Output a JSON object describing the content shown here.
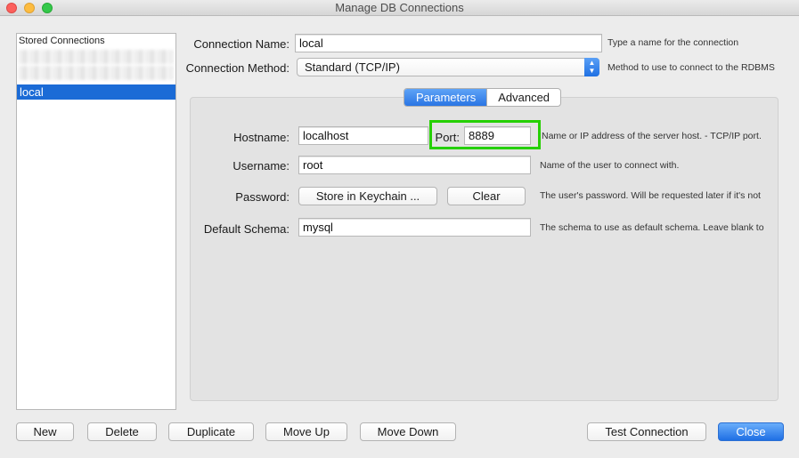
{
  "window": {
    "title": "Manage DB Connections"
  },
  "stored_connections": {
    "header": "Stored Connections",
    "items": [
      "local"
    ],
    "selected": "local"
  },
  "form": {
    "connection_name_label": "Connection Name:",
    "connection_name_value": "local",
    "connection_name_hint": "Type a name for the connection",
    "connection_method_label": "Connection Method:",
    "connection_method_value": "Standard (TCP/IP)",
    "connection_method_hint": "Method to use to connect to the RDBMS"
  },
  "tabs": [
    {
      "label": "Parameters",
      "active": true
    },
    {
      "label": "Advanced",
      "active": false
    }
  ],
  "parameters": {
    "hostname_label": "Hostname:",
    "hostname_value": "localhost",
    "port_label": "Port:",
    "port_value": "8889",
    "hostname_hint": "Name or IP address of the server host. - TCP/IP port.",
    "username_label": "Username:",
    "username_value": "root",
    "username_hint": "Name of the user to connect with.",
    "password_label": "Password:",
    "store_keychain_label": "Store in Keychain ...",
    "clear_label": "Clear",
    "password_hint": "The user's password. Will be requested later if it's not",
    "schema_label": "Default Schema:",
    "schema_value": "mysql",
    "schema_hint": "The schema to use as default schema. Leave blank to"
  },
  "bottom_buttons": {
    "new": "New",
    "delete": "Delete",
    "duplicate": "Duplicate",
    "move_up": "Move Up",
    "move_down": "Move Down",
    "test_connection": "Test Connection",
    "close": "Close"
  },
  "colors": {
    "selection": "#1b6bd6",
    "accent": "#2a75e4",
    "highlight": "#25d000"
  }
}
